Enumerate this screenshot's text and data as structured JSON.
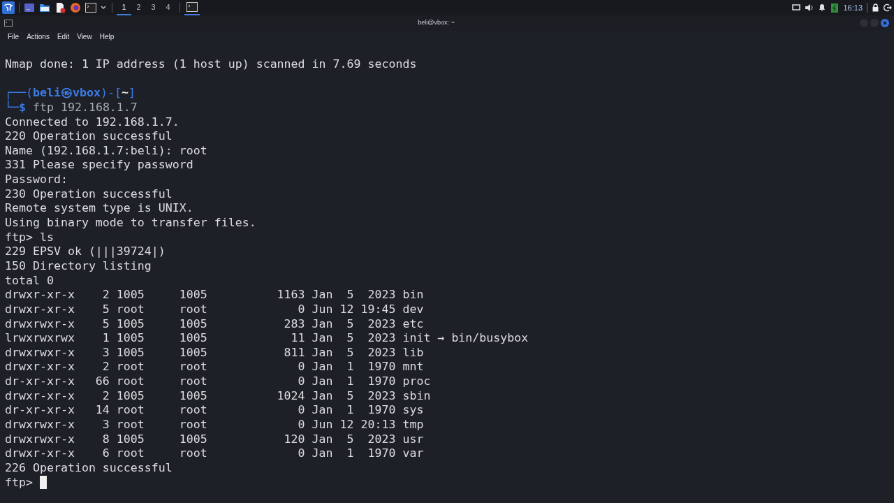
{
  "taskbar": {
    "workspaces": [
      {
        "label": "1",
        "selected": true
      },
      {
        "label": "2",
        "selected": false
      },
      {
        "label": "3",
        "selected": false
      },
      {
        "label": "4",
        "selected": false
      }
    ],
    "clock": "16:13"
  },
  "window": {
    "title": "beli@vbox: ~",
    "menu": [
      "File",
      "Actions",
      "Edit",
      "View",
      "Help"
    ]
  },
  "terminal": {
    "lines": [
      {
        "kind": "text",
        "text": "Nmap done: 1 IP address (1 host up) scanned in 7.69 seconds"
      },
      {
        "kind": "blank"
      },
      {
        "kind": "prompt",
        "parts": [
          {
            "text": "┌──(",
            "kind": "frame"
          },
          {
            "text": "beli㉿vbox",
            "kind": "user"
          },
          {
            "text": ")-[",
            "kind": "frame"
          },
          {
            "text": "~",
            "kind": "dir"
          },
          {
            "text": "]",
            "kind": "frame"
          }
        ]
      },
      {
        "kind": "prompt",
        "parts": [
          {
            "text": "└─",
            "kind": "frame"
          },
          {
            "text": "$",
            "kind": "user"
          },
          {
            "text": " ftp 192.168.1.7",
            "kind": "command"
          }
        ]
      },
      {
        "kind": "text",
        "text": "Connected to 192.168.1.7."
      },
      {
        "kind": "text",
        "text": "220 Operation successful"
      },
      {
        "kind": "text",
        "text": "Name (192.168.1.7:beli): root"
      },
      {
        "kind": "text",
        "text": "331 Please specify password"
      },
      {
        "kind": "text",
        "text": "Password:"
      },
      {
        "kind": "text",
        "text": "230 Operation successful"
      },
      {
        "kind": "text",
        "text": "Remote system type is UNIX."
      },
      {
        "kind": "text",
        "text": "Using binary mode to transfer files."
      },
      {
        "kind": "text",
        "text": "ftp> ls"
      },
      {
        "kind": "text",
        "text": "229 EPSV ok (|||39724|)"
      },
      {
        "kind": "text",
        "text": "150 Directory listing"
      },
      {
        "kind": "text",
        "text": "total 0"
      },
      {
        "kind": "text",
        "text": "drwxr-xr-x    2 1005     1005          1163 Jan  5  2023 bin"
      },
      {
        "kind": "text",
        "text": "drwxr-xr-x    5 root     root             0 Jun 12 19:45 dev"
      },
      {
        "kind": "text",
        "text": "drwxrwxr-x    5 1005     1005           283 Jan  5  2023 etc"
      },
      {
        "kind": "text",
        "text": "lrwxrwxrwx    1 1005     1005            11 Jan  5  2023 init → bin/busybox"
      },
      {
        "kind": "text",
        "text": "drwxrwxr-x    3 1005     1005           811 Jan  5  2023 lib"
      },
      {
        "kind": "text",
        "text": "drwxr-xr-x    2 root     root             0 Jan  1  1970 mnt"
      },
      {
        "kind": "text",
        "text": "dr-xr-xr-x   66 root     root             0 Jan  1  1970 proc"
      },
      {
        "kind": "text",
        "text": "drwxr-xr-x    2 1005     1005          1024 Jan  5  2023 sbin"
      },
      {
        "kind": "text",
        "text": "dr-xr-xr-x   14 root     root             0 Jan  1  1970 sys"
      },
      {
        "kind": "text",
        "text": "drwxrwxr-x    3 root     root             0 Jun 12 20:13 tmp"
      },
      {
        "kind": "text",
        "text": "drwxrwxr-x    8 1005     1005           120 Jan  5  2023 usr"
      },
      {
        "kind": "text",
        "text": "drwxr-xr-x    6 root     root             0 Jan  1  1970 var"
      },
      {
        "kind": "text",
        "text": "226 Operation successful"
      },
      {
        "kind": "input",
        "text": "ftp>",
        "cursor": true
      }
    ]
  }
}
